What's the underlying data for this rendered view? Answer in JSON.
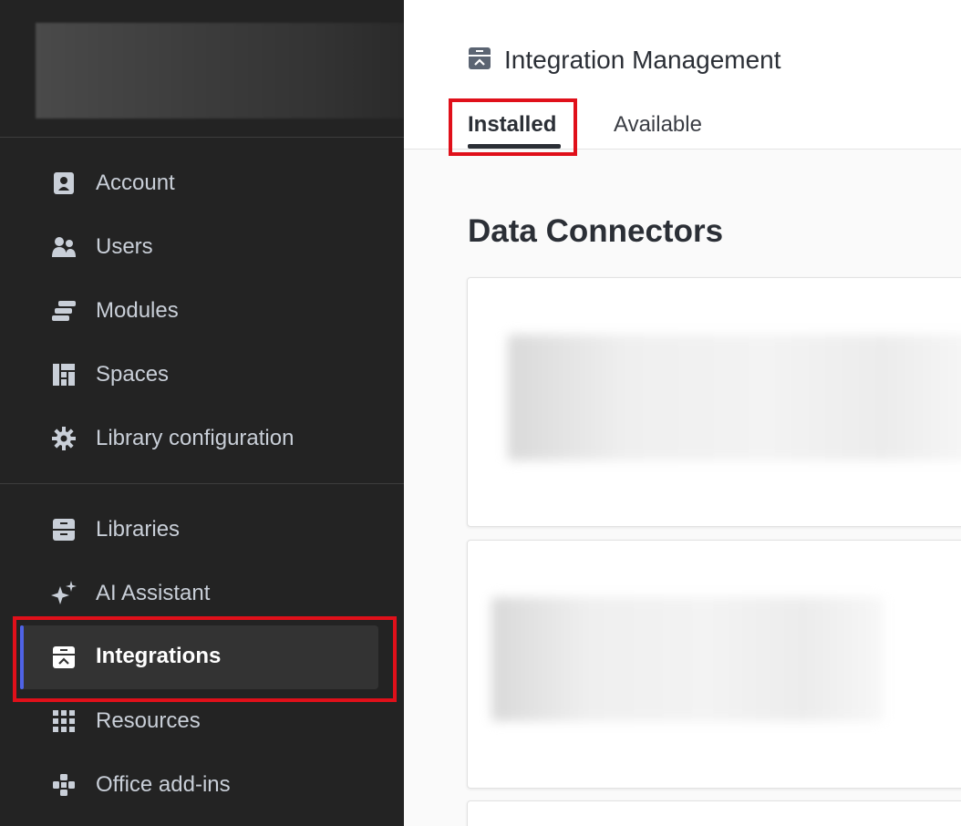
{
  "sidebar": {
    "group1": [
      {
        "label": "Account",
        "icon": "account-icon"
      },
      {
        "label": "Users",
        "icon": "users-icon"
      },
      {
        "label": "Modules",
        "icon": "modules-icon"
      },
      {
        "label": "Spaces",
        "icon": "spaces-icon"
      },
      {
        "label": "Library configuration",
        "icon": "gear-icon"
      }
    ],
    "group2": [
      {
        "label": "Libraries",
        "icon": "libraries-icon"
      },
      {
        "label": "AI Assistant",
        "icon": "sparkle-icon"
      },
      {
        "label": "Integrations",
        "icon": "integrations-icon",
        "active": true
      },
      {
        "label": "Resources",
        "icon": "resources-icon"
      },
      {
        "label": "Office add-ins",
        "icon": "office-addins-icon"
      }
    ]
  },
  "header": {
    "title": "Integration Management",
    "tabs": [
      {
        "label": "Installed",
        "active": true
      },
      {
        "label": "Available",
        "active": false
      }
    ]
  },
  "main": {
    "section_title": "Data Connectors"
  },
  "colors": {
    "sidebar_bg": "#232323",
    "active_indicator": "#4f63e6",
    "highlight": "#e0101a"
  }
}
